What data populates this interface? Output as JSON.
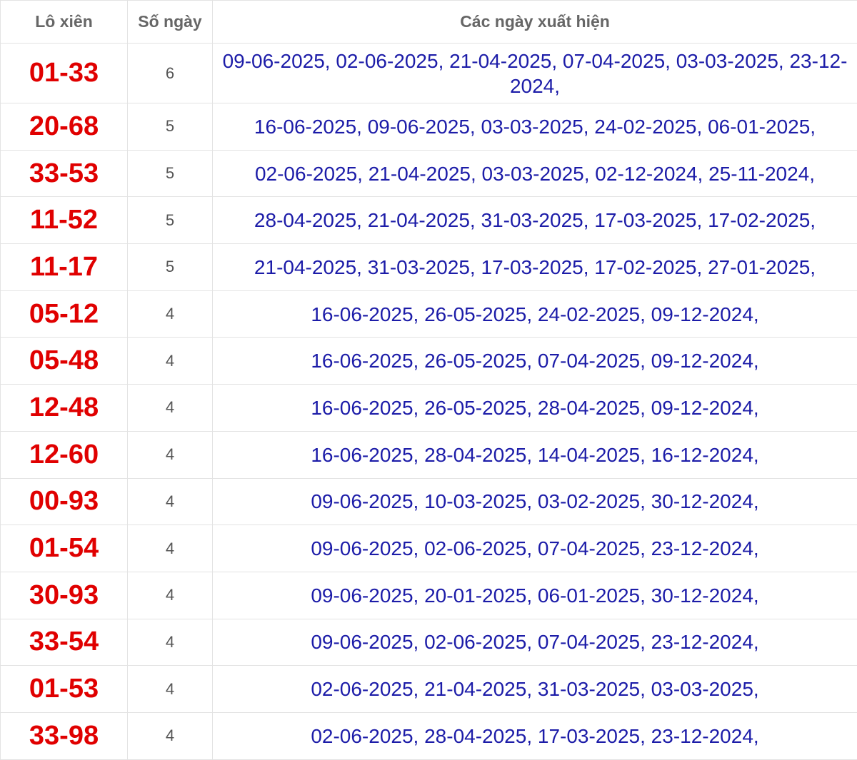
{
  "header": {
    "col_pair": "Lô xiên",
    "col_count": "Số ngày",
    "col_dates": "Các ngày xuất hiện"
  },
  "rows": [
    {
      "pair": "01-33",
      "count": "6",
      "dates": "09-06-2025, 02-06-2025, 21-04-2025, 07-04-2025, 03-03-2025, 23-12-2024,"
    },
    {
      "pair": "20-68",
      "count": "5",
      "dates": "16-06-2025, 09-06-2025, 03-03-2025, 24-02-2025, 06-01-2025,"
    },
    {
      "pair": "33-53",
      "count": "5",
      "dates": "02-06-2025, 21-04-2025, 03-03-2025, 02-12-2024, 25-11-2024,"
    },
    {
      "pair": "11-52",
      "count": "5",
      "dates": "28-04-2025, 21-04-2025, 31-03-2025, 17-03-2025, 17-02-2025,"
    },
    {
      "pair": "11-17",
      "count": "5",
      "dates": "21-04-2025, 31-03-2025, 17-03-2025, 17-02-2025, 27-01-2025,"
    },
    {
      "pair": "05-12",
      "count": "4",
      "dates": "16-06-2025, 26-05-2025, 24-02-2025, 09-12-2024,"
    },
    {
      "pair": "05-48",
      "count": "4",
      "dates": "16-06-2025, 26-05-2025, 07-04-2025, 09-12-2024,"
    },
    {
      "pair": "12-48",
      "count": "4",
      "dates": "16-06-2025, 26-05-2025, 28-04-2025, 09-12-2024,"
    },
    {
      "pair": "12-60",
      "count": "4",
      "dates": "16-06-2025, 28-04-2025, 14-04-2025, 16-12-2024,"
    },
    {
      "pair": "00-93",
      "count": "4",
      "dates": "09-06-2025, 10-03-2025, 03-02-2025, 30-12-2024,"
    },
    {
      "pair": "01-54",
      "count": "4",
      "dates": "09-06-2025, 02-06-2025, 07-04-2025, 23-12-2024,"
    },
    {
      "pair": "30-93",
      "count": "4",
      "dates": "09-06-2025, 20-01-2025, 06-01-2025, 30-12-2024,"
    },
    {
      "pair": "33-54",
      "count": "4",
      "dates": "09-06-2025, 02-06-2025, 07-04-2025, 23-12-2024,"
    },
    {
      "pair": "01-53",
      "count": "4",
      "dates": "02-06-2025, 21-04-2025, 31-03-2025, 03-03-2025,"
    },
    {
      "pair": "33-98",
      "count": "4",
      "dates": "02-06-2025, 28-04-2025, 17-03-2025, 23-12-2024,"
    }
  ]
}
